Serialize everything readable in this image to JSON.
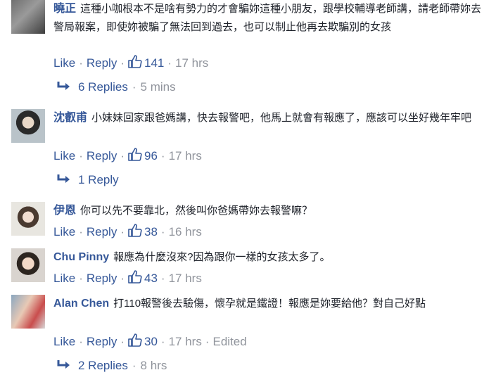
{
  "comments": [
    {
      "name": "曉正",
      "text": "這種小咖根本不是啥有勢力的才會騙妳這種小朋友，跟學校輔導老師講，請老師帶妳去警局報案，即使妳被騙了無法回到過去，也可以制止他再去欺騙別的女孩",
      "like": "Like",
      "reply": "Reply",
      "likes": "141",
      "time": "17 hrs",
      "replies": "6 Replies",
      "replies_time": "5 mins"
    },
    {
      "name": "沈叡甫",
      "text": "小妹妹回家跟爸媽講，快去報警吧，他馬上就會有報應了，應該可以坐好幾年牢吧",
      "like": "Like",
      "reply": "Reply",
      "likes": "96",
      "time": "17 hrs",
      "replies": "1 Reply",
      "replies_time": ""
    },
    {
      "name": "伊恩",
      "text": "你可以先不要靠北，然後叫你爸媽帶妳去報警嘛？",
      "like": "Like",
      "reply": "Reply",
      "likes": "38",
      "time": "16 hrs"
    },
    {
      "name": "Chu Pinny",
      "text": "報應為什麼沒來?因為跟你一樣的女孩太多了。",
      "like": "Like",
      "reply": "Reply",
      "likes": "43",
      "time": "17 hrs"
    },
    {
      "name": "Alan Chen",
      "text": "打110報警後去驗傷，懷孕就是鐵證！報應是妳要給他？對自己好點",
      "like": "Like",
      "reply": "Reply",
      "likes": "30",
      "time": "17 hrs",
      "edited": "Edited",
      "replies": "2 Replies",
      "replies_time": "8 hrs"
    }
  ],
  "icons": {
    "like_count": "thumbs-up-icon",
    "reply_arrow": "reply-arrow-icon"
  },
  "colors": {
    "link": "#365899",
    "meta_grey": "#90949c",
    "text": "#1d2129"
  }
}
